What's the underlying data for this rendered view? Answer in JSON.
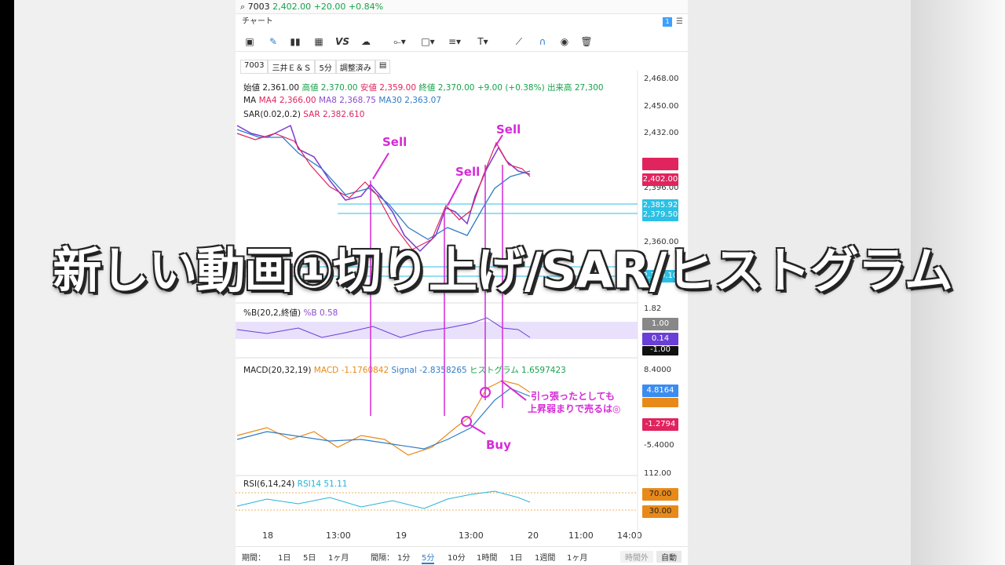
{
  "header": {
    "symbol": "7003",
    "price": "2,402.00",
    "change": "+20.00 +0.84%"
  },
  "tab": {
    "label": "チャート",
    "badge": "1",
    "menu": "☰"
  },
  "info": {
    "symbol": "7003",
    "name": "三井Ｅ＆Ｓ",
    "interval": "5分",
    "adjust": "調整済み"
  },
  "ohlc": {
    "open_label": "始値",
    "open": "2,361.00",
    "high_label": "高値",
    "high": "2,370.00",
    "low_label": "安値",
    "low": "2,359.00",
    "close_label": "終値",
    "close": "2,370.00",
    "chg": "+9.00 (+0.38%)",
    "vol_label": "出来高",
    "vol": "27,300"
  },
  "ma": {
    "label": "MA",
    "ma4": "MA4 2,366.00",
    "ma8": "MA8 2,368.75",
    "ma30": "MA30 2,363.07"
  },
  "sar": {
    "label": "SAR(0.02,0.2)",
    "value": "SAR 2,382.610"
  },
  "pctb": {
    "label": "%B(20,2,終値)",
    "value": "%B 0.58"
  },
  "macd": {
    "label": "MACD(20,32,19)",
    "macd": "MACD -1.1760842",
    "signal": "Signal -2.8358265",
    "hist": "ヒストグラム 1.6597423"
  },
  "rsi": {
    "label": "RSI(6,14,24)",
    "value": "RSI14 51.11"
  },
  "y_axis": [
    "2,468.00",
    "2,450.00",
    "2,432.00",
    "2,396.00",
    "2,360.00"
  ],
  "price_tags": {
    "t1": "2,402.00",
    "t2": "2,385.92",
    "t3": "2,379.50",
    "t4": "2,389.10"
  },
  "pctb_axis": {
    "top": "1.82",
    "t1": "1.00",
    "t2": "0.14",
    "t3": "-1.00"
  },
  "macd_axis": {
    "top": "8.4000",
    "t1": "4.8164",
    "t2": "-1.2794",
    "bottom": "-5.4000"
  },
  "rsi_axis": {
    "top": "112.00",
    "t1": "70.00",
    "t2": "30.00"
  },
  "x_axis": [
    "18",
    "13:00",
    "19",
    "13:00",
    "20",
    "11:00",
    "14:00"
  ],
  "bottom_bar": {
    "period_label": "期間：",
    "p1": "1日",
    "p2": "5日",
    "p3": "1ヶ月",
    "interval_label": "間隔：",
    "i1": "1分",
    "i2": "5分",
    "i3": "10分",
    "i4": "1時間",
    "i5": "1日",
    "i6": "1週間",
    "i7": "1ヶ月",
    "after": "時間外",
    "auto": "自動"
  },
  "annotations": {
    "sell1": "Sell",
    "sell2": "Sell",
    "sell3": "Sell",
    "buy": "Buy",
    "note1": "引っ張ったとしても",
    "note2": "上昇弱まりで売るは◎"
  },
  "overlay_title": "新しい動画①切り上げ/SAR/ヒストグラム"
}
